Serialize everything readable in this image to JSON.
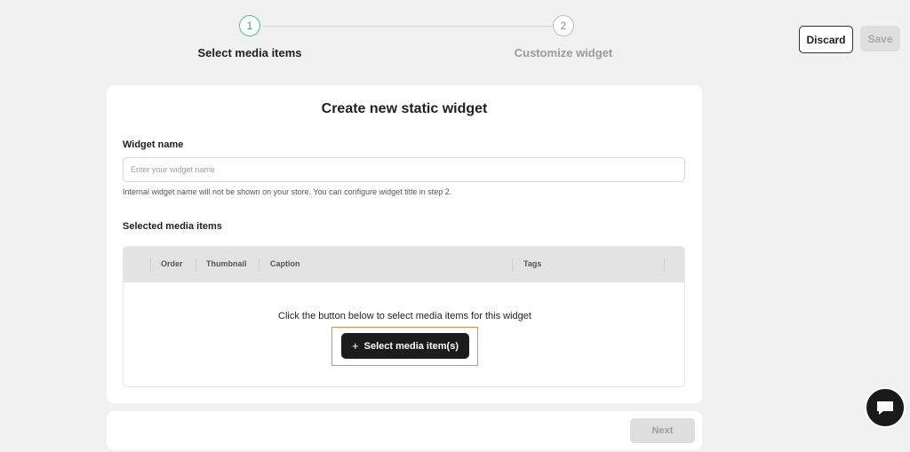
{
  "stepper": {
    "steps": [
      {
        "number": "1",
        "label": "Select media items",
        "state": "active"
      },
      {
        "number": "2",
        "label": "Customize widget",
        "state": "inactive"
      }
    ]
  },
  "header": {
    "discard_label": "Discard",
    "save_label": "Save"
  },
  "card": {
    "title": "Create new static widget",
    "widget_name": {
      "label": "Widget name",
      "value": "",
      "placeholder": "Enter your widget name",
      "help": "Internal widget name will not be shown on your store. You can configure widget title in step 2."
    },
    "media": {
      "label": "Selected media items",
      "columns": [
        "Order",
        "Thumbnail",
        "Caption",
        "Tags"
      ],
      "empty_text": "Click the button below to select media items for this widget",
      "select_button_label": "Select media item(s)",
      "select_button_icon": "plus-icon"
    }
  },
  "footer": {
    "next_label": "Next"
  },
  "chat": {
    "icon": "chat-bubble-icon"
  },
  "colors": {
    "accent_step": "#4fc08d",
    "highlight_frame": "#ec8a46",
    "primary_button": "#1c1c1c",
    "disabled_button": "#dedede"
  }
}
